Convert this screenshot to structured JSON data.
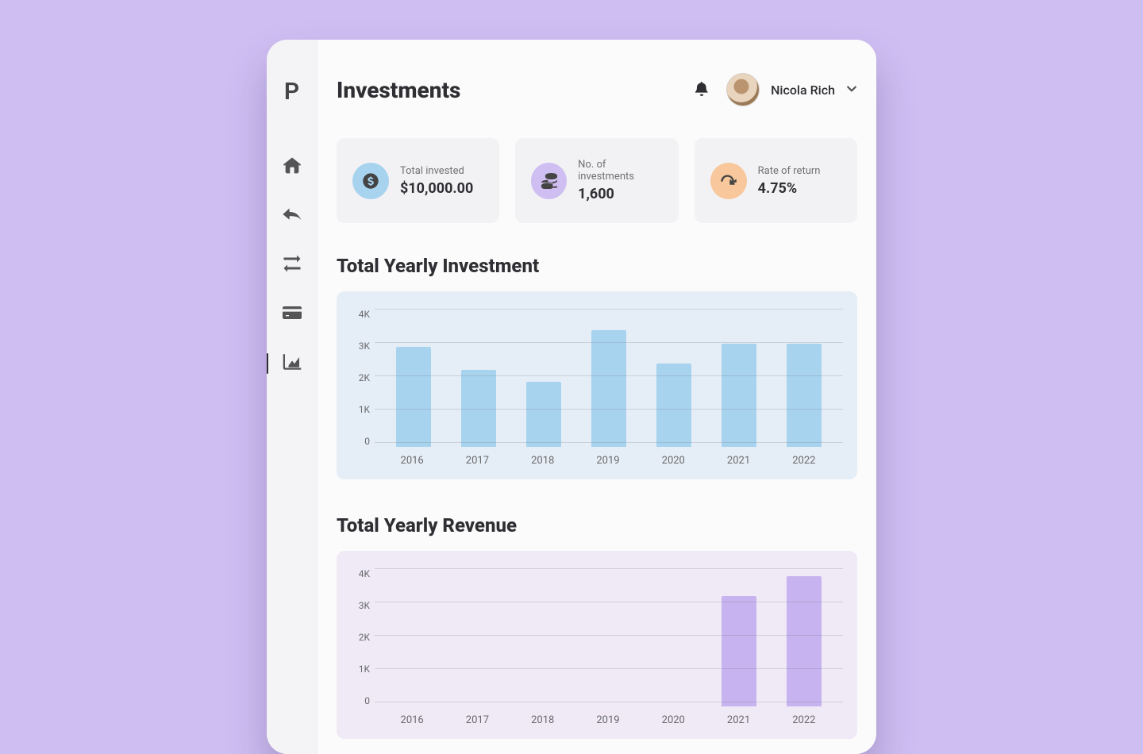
{
  "sidebar": {
    "logo": "P"
  },
  "header": {
    "title": "Investments",
    "user_name": "Nicola Rich"
  },
  "stats": {
    "invested": {
      "label": "Total invested",
      "value": "$10,000.00"
    },
    "count": {
      "label": "No. of investments",
      "value": "1,600"
    },
    "rate": {
      "label": "Rate of return",
      "value": "4.75%"
    }
  },
  "sections": {
    "yearly_investment_title": "Total Yearly Investment",
    "yearly_revenue_title": "Total Yearly Revenue"
  },
  "chart_data": [
    {
      "id": "yearly_investment",
      "type": "bar",
      "title": "Total Yearly Investment",
      "xlabel": "",
      "ylabel": "",
      "categories": [
        "2016",
        "2017",
        "2018",
        "2019",
        "2020",
        "2021",
        "2022"
      ],
      "values": [
        3000,
        2300,
        1950,
        3500,
        2500,
        3100,
        3100
      ],
      "y_ticks": [
        "4K",
        "3K",
        "2K",
        "1K",
        "0"
      ],
      "ylim": [
        0,
        4000
      ]
    },
    {
      "id": "yearly_revenue",
      "type": "bar",
      "title": "Total Yearly Revenue",
      "xlabel": "",
      "ylabel": "",
      "categories": [
        "2016",
        "2017",
        "2018",
        "2019",
        "2020",
        "2021",
        "2022"
      ],
      "values": [
        null,
        null,
        null,
        null,
        null,
        3300,
        3900
      ],
      "y_ticks": [
        "4K",
        "3K",
        "2K",
        "1K",
        "0"
      ],
      "ylim": [
        0,
        4000
      ],
      "note": "only top of chart visible; bars for 2021 and 2022 partially shown"
    }
  ]
}
